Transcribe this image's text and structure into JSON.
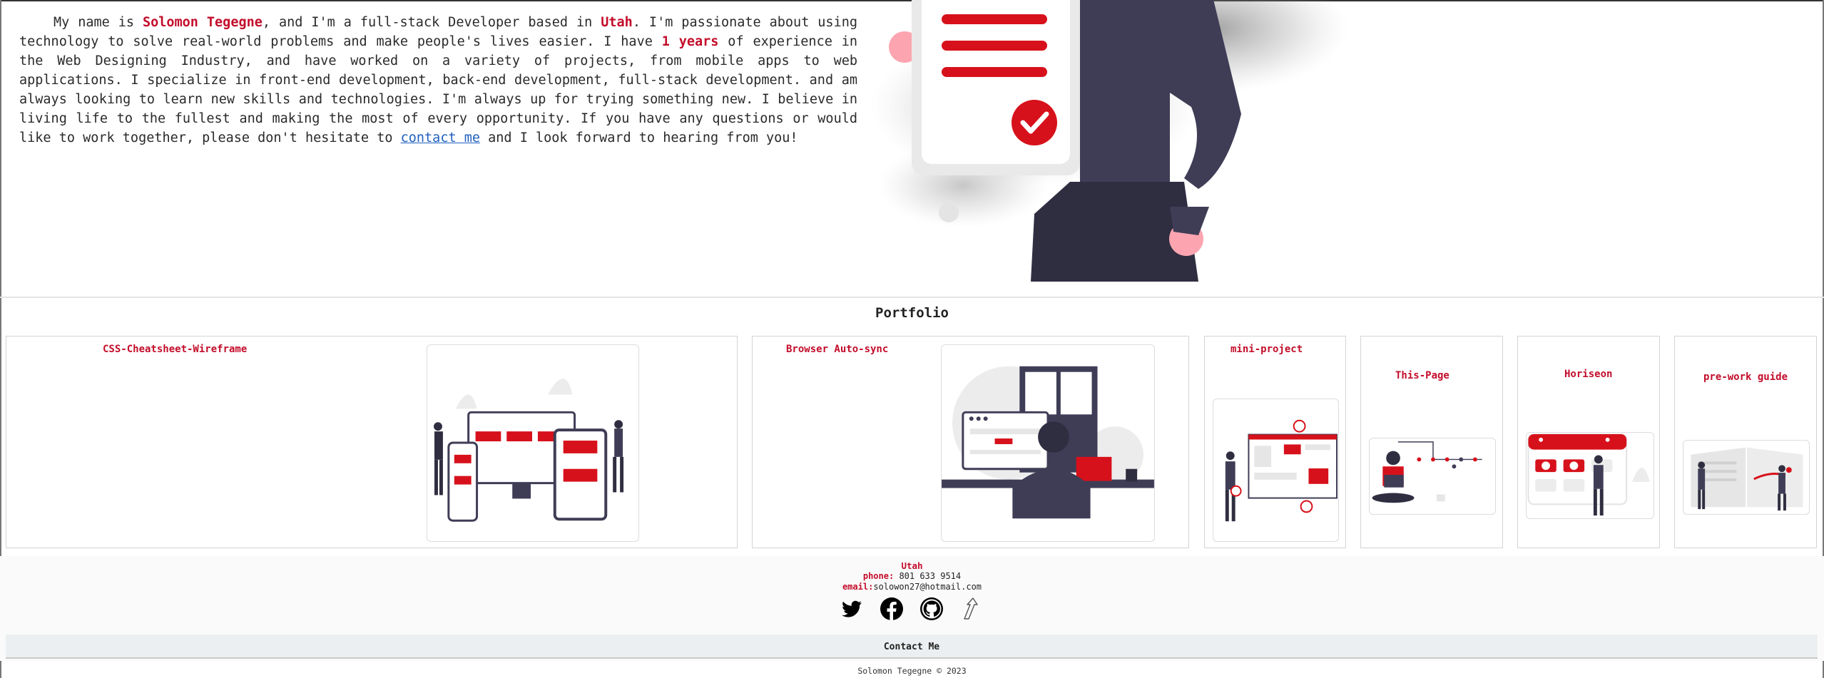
{
  "about": {
    "intro_1": "My name is ",
    "name": "Solomon Tegegne",
    "intro_2": ", and I'm a full-stack Developer based in ",
    "location": "Utah",
    "intro_3": ". I'm passionate about using technology to solve real-world problems and make people's lives easier. I have ",
    "years": "1 years",
    "intro_4": " of experience in the Web Designing Industry, and have worked on a variety of projects, from mobile apps to web applications. I specialize in front-end development, back-end development, full-stack development. and am always looking to learn new skills and technologies. I'm always up for trying something new. I believe in living life to the fullest and making the most of every opportunity. If you have any questions or would like to work together, please don't hesitate to ",
    "contact_link": "contact me",
    "intro_5": " and I look forward to hearing from you!"
  },
  "portfolio": {
    "title": "Portfolio",
    "projects": [
      {
        "title": "CSS-Cheatsheet-Wireframe"
      },
      {
        "title": "Browser Auto-sync"
      },
      {
        "title": "mini-project"
      },
      {
        "title": "This-Page"
      },
      {
        "title": "Horiseon"
      },
      {
        "title": "pre-work guide"
      }
    ]
  },
  "footer": {
    "city": "Utah",
    "phone_label": "phone:",
    "phone": "801 633 9514",
    "email_label": "email:",
    "email": "solowon27@hotmail.com",
    "socials": [
      "twitter-icon",
      "facebook-icon",
      "github-icon",
      "scroll-up-icon"
    ],
    "contact_button": "Contact Me",
    "copyright": "Solomon Tegegne © 2023"
  },
  "colors": {
    "accent": "#c30d2a",
    "link": "#1f5fbf",
    "dark": "#3f3d56",
    "contact_bar": "#eceff1"
  }
}
